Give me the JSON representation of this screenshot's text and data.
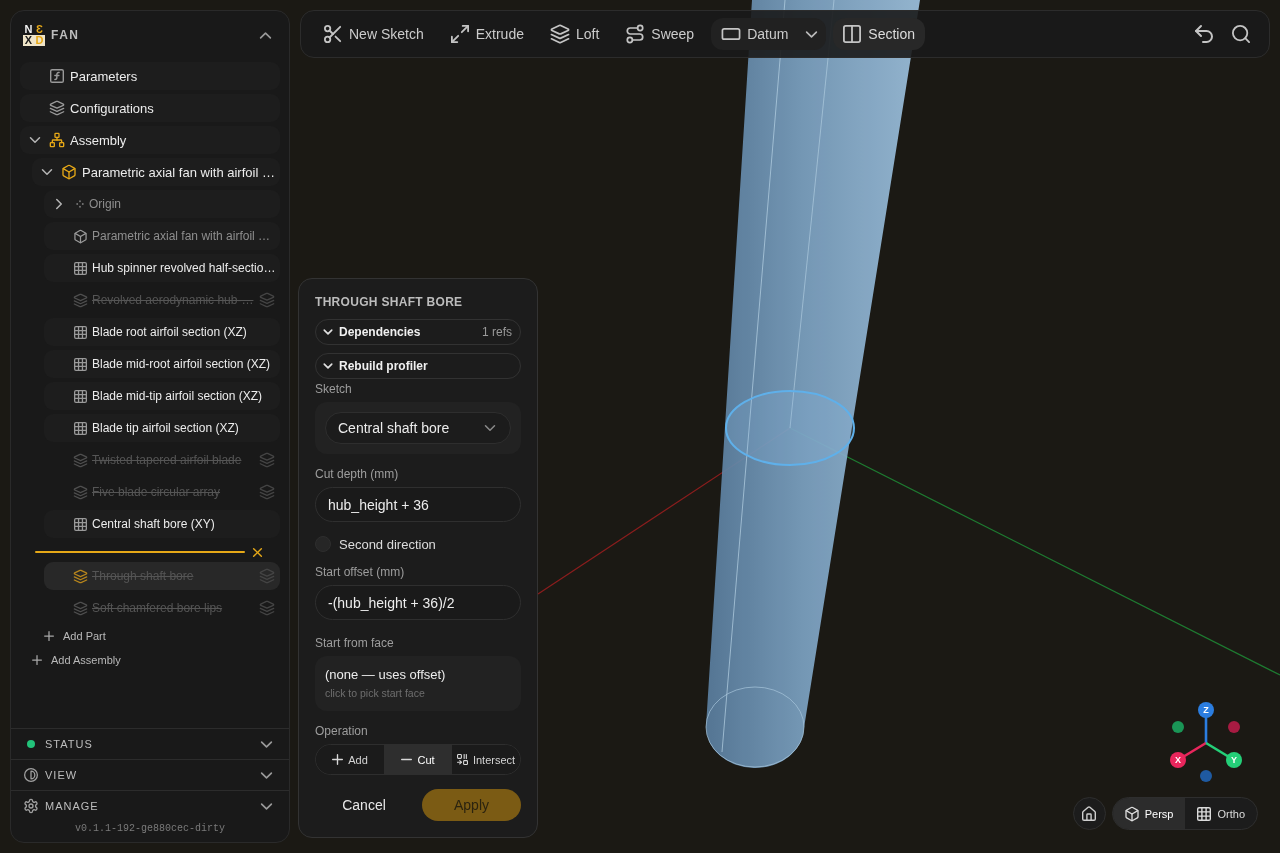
{
  "sidebar": {
    "logo": {
      "letters": [
        "N",
        "Ɛ",
        "X",
        "D"
      ]
    },
    "project": "FAN",
    "tree": [
      {
        "kind": "parameters",
        "label": "Parameters",
        "selected": false
      },
      {
        "kind": "configurations",
        "label": "Configurations",
        "selected": false
      },
      {
        "kind": "assembly",
        "label": "Assembly",
        "expanded": true,
        "selected": false,
        "children": [
          {
            "kind": "part",
            "label": "Parametric axial fan with airfoil …",
            "expanded": true,
            "selected": false,
            "children": [
              {
                "kind": "origin",
                "label": "Origin",
                "expanded": false,
                "selected": false
              },
              {
                "kind": "body",
                "label": "Parametric axial fan with airfoil …",
                "selected": false
              },
              {
                "kind": "sketch",
                "label": "Hub spinner revolved half-sectio…",
                "suppressed": false,
                "selected": false
              },
              {
                "kind": "feature",
                "label": "Revolved aerodynamic hub-…",
                "suppressed": true,
                "selected": false
              },
              {
                "kind": "sketch",
                "label": "Blade root airfoil section (XZ)",
                "suppressed": false,
                "selected": false
              },
              {
                "kind": "sketch",
                "label": "Blade mid-root airfoil section (XZ)",
                "suppressed": false,
                "selected": false
              },
              {
                "kind": "sketch",
                "label": "Blade mid-tip airfoil section (XZ)",
                "suppressed": false,
                "selected": false
              },
              {
                "kind": "sketch",
                "label": "Blade tip airfoil section (XZ)",
                "suppressed": false,
                "selected": false
              },
              {
                "kind": "feature",
                "label": "Twisted tapered airfoil blade",
                "suppressed": true,
                "selected": false
              },
              {
                "kind": "feature",
                "label": "Five blade circular array",
                "suppressed": true,
                "selected": false
              },
              {
                "kind": "sketch",
                "label": "Central shaft bore (XY)",
                "suppressed": false,
                "selected": false
              },
              {
                "kind": "rollback"
              },
              {
                "kind": "feature",
                "label": "Through shaft bore",
                "suppressed": true,
                "selected": true
              },
              {
                "kind": "feature",
                "label": "Soft chamfered bore lips",
                "suppressed": true,
                "selected": false
              }
            ]
          },
          {
            "kind": "add",
            "label": "Add Part"
          }
        ]
      },
      {
        "kind": "add",
        "label": "Add Assembly"
      }
    ],
    "sections": [
      {
        "kind": "status",
        "label": "STATUS",
        "color": "#22c37a"
      },
      {
        "kind": "view",
        "label": "VIEW"
      },
      {
        "kind": "manage",
        "label": "MANAGE"
      }
    ],
    "version": "v0.1.1-192-ge880cec-dirty"
  },
  "toolbar": {
    "tools": [
      {
        "kind": "button",
        "label": "New Sketch",
        "on": false
      },
      {
        "kind": "button",
        "label": "Extrude",
        "on": false
      },
      {
        "kind": "button",
        "label": "Loft",
        "on": false
      },
      {
        "kind": "button",
        "label": "Sweep",
        "on": false
      },
      {
        "kind": "split",
        "label": "Datum",
        "on": false
      },
      {
        "kind": "button",
        "label": "Section",
        "on": true
      }
    ]
  },
  "feature_panel": {
    "title": "THROUGH SHAFT BORE",
    "sections": [
      {
        "label": "Dependencies",
        "count": "1 refs"
      },
      {
        "label": "Rebuild profiler"
      }
    ],
    "fields": [
      {
        "kind": "select",
        "label": "Sketch",
        "value": "Central shaft bore"
      },
      {
        "kind": "input",
        "label": "Cut depth (mm)",
        "value": "hub_height + 36"
      },
      {
        "kind": "checkbox",
        "label": "Second direction",
        "checked": false
      },
      {
        "kind": "input",
        "label": "Start offset (mm)",
        "value": "-(hub_height + 36)/2"
      },
      {
        "kind": "face",
        "label": "Start from face",
        "value": "(none — uses offset)",
        "hint": "click to pick start face"
      },
      {
        "kind": "segmented",
        "label": "Operation",
        "options": [
          {
            "kind": "add",
            "label": "Add",
            "selected": false
          },
          {
            "kind": "cut",
            "label": "Cut",
            "selected": true
          },
          {
            "kind": "intersect",
            "label": "Intersect",
            "selected": false
          }
        ]
      }
    ],
    "actions": [
      {
        "kind": "text",
        "label": "Cancel"
      },
      {
        "kind": "primary",
        "label": "Apply"
      }
    ]
  },
  "viewport": {
    "gizmo": {
      "axes": [
        {
          "label": "Z",
          "color": "#2b7de0"
        },
        {
          "label": "X",
          "color": "#e8265c"
        },
        {
          "label": "Y",
          "color": "#24cf78"
        }
      ]
    },
    "view_modes": [
      {
        "label": "Persp",
        "selected": true
      },
      {
        "label": "Ortho",
        "selected": false
      }
    ]
  }
}
